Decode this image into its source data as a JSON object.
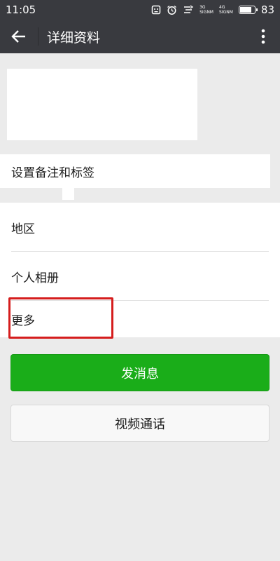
{
  "status_bar": {
    "time": "11:05",
    "signal_3g": "3G",
    "signal_4g": "4G",
    "signal_label": "SIGNM",
    "battery_level": "83"
  },
  "nav": {
    "title": "详细资料"
  },
  "tag_row": {
    "label": "设置备注和标签"
  },
  "info_rows": [
    {
      "label": "地区"
    },
    {
      "label": "个人相册"
    },
    {
      "label": "更多"
    }
  ],
  "buttons": {
    "send_label": "发消息",
    "video_label": "视频通话"
  },
  "colors": {
    "header_bg": "#393a3f",
    "page_bg": "#ebebeb",
    "primary_green": "#1aad19",
    "highlight_red": "#d51d1d"
  }
}
